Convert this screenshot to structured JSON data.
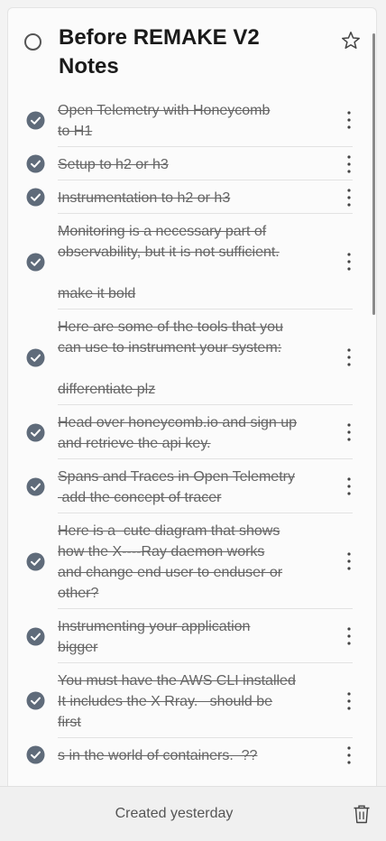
{
  "note": {
    "title": "Before REMAKE V2 Notes",
    "items": [
      {
        "text": "Open Telemetry with Honeycomb\nto H1",
        "completed": true
      },
      {
        "text": "Setup to h2 or h3",
        "completed": true
      },
      {
        "text": "Instrumentation to h2 or h3",
        "completed": true
      },
      {
        "text": "Monitoring is a necessary part of\nobservability, but it is not sufficient.\n\nmake it bold",
        "completed": true
      },
      {
        "text": "Here are some of the tools that you\ncan use to instrument your system:\n\ndifferentiate plz",
        "completed": true
      },
      {
        "text": "Head over honeycomb.io and sign up\nand retrieve the api key.",
        "completed": true
      },
      {
        "text": "Spans and Traces in Open Telemetry\n add the concept of tracer",
        "completed": true
      },
      {
        "text": "Here is a  cute diagram that shows\nhow the X----Ray daemon works\nand change end user to enduser or\nother?",
        "completed": true
      },
      {
        "text": "Instrumenting your application\nbigger",
        "completed": true
      },
      {
        "text": "You must have the AWS CLI installed\nIt includes the X Rray.   should be\nfirst",
        "completed": true
      },
      {
        "text": "s in the world of containers.  ??",
        "completed": true
      }
    ]
  },
  "footer": {
    "created_label": "Created yesterday"
  },
  "icons": {
    "mark_complete": "circle-outline-icon",
    "star": "star-outline-icon",
    "item_check": "check-circle-filled-icon",
    "more": "more-vertical-icon",
    "delete": "trash-icon"
  },
  "colors": {
    "check_fill": "#5f6b7a",
    "completed_text": "#666666",
    "background": "#fbfbfb"
  }
}
